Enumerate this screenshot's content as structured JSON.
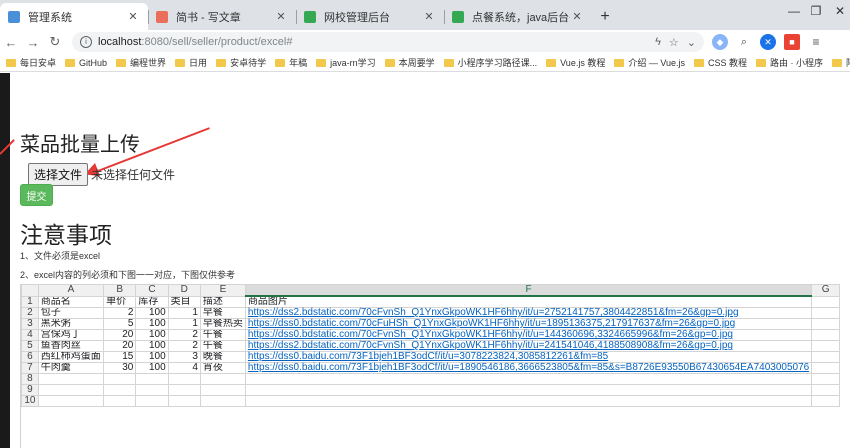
{
  "browser": {
    "tabs": [
      {
        "title": "管理系统",
        "favicon_color": "#4a90d9",
        "active": true
      },
      {
        "title": "简书 - 写文章",
        "favicon_color": "#ea6f5a",
        "active": false
      },
      {
        "title": "网校管理后台",
        "favicon_color": "#34a853",
        "active": false
      },
      {
        "title": "点餐系统，java后台+点餐小程序 - ",
        "favicon_color": "#34a853",
        "active": false
      }
    ],
    "new_tab": "+",
    "window": {
      "minimize": "—",
      "maximize": "❐",
      "close": "✕"
    },
    "url_host": "localhost",
    "url_path": ":8080/sell/seller/product/excel#",
    "nav": {
      "back": "←",
      "forward": "→",
      "reload": "↻"
    },
    "bookmarks": [
      "每日安卓",
      "GitHub",
      "编程世界",
      "日用",
      "安卓待学",
      "年稿",
      "java-rn学习",
      "本周要学",
      "小程序学习路径课...",
      "Vue.js 教程",
      "介绍 — Vue.js",
      "CSS 教程",
      "路由 · 小程序",
      "阿里云推荐有礼活动"
    ],
    "bookmarks_more": "»"
  },
  "page": {
    "upload_heading": "菜品批量上传",
    "choose_file_button": "选择文件",
    "no_file_text": "未选择任何文件",
    "submit_button": "提交",
    "notes_heading": "注意事项",
    "notes": [
      "1、文件必须是excel",
      "2、excel内容的列必须和下图一一对应，下图仅供参考"
    ]
  },
  "sheet": {
    "col_letters": [
      "A",
      "B",
      "C",
      "D",
      "E",
      "F",
      "G"
    ],
    "rows": [
      {
        "n": "1",
        "cells": [
          "商品名",
          "单价",
          "库存",
          "类目",
          "描述",
          "商品图片",
          ""
        ]
      },
      {
        "n": "2",
        "cells": [
          "包子",
          "2",
          "100",
          "1",
          "早餐",
          "https://dss2.bdstatic.com/70cFvnSh_Q1YnxGkpoWK1HF6hhy/it/u=2752141757,3804422851&fm=26&gp=0.jpg",
          ""
        ]
      },
      {
        "n": "3",
        "cells": [
          "黑米粥",
          "5",
          "100",
          "1",
          "早餐热卖",
          "https://dss0.bdstatic.com/70cFuHSh_Q1YnxGkpoWK1HF6hhy/it/u=1895136375,217917637&fm=26&gp=0.jpg",
          ""
        ]
      },
      {
        "n": "4",
        "cells": [
          "宫保鸡丁",
          "20",
          "100",
          "2",
          "午餐",
          "https://dss0.bdstatic.com/70cFvnSh_Q1YnxGkpoWK1HF6hhy/it/u=144360696,3324665996&fm=26&gp=0.jpg",
          ""
        ]
      },
      {
        "n": "5",
        "cells": [
          "鱼香肉丝",
          "20",
          "100",
          "2",
          "午餐",
          "https://dss2.bdstatic.com/70cFvnSh_Q1YnxGkpoWK1HF6hhy/it/u=241541046,4188508908&fm=26&gp=0.jpg",
          ""
        ]
      },
      {
        "n": "6",
        "cells": [
          "西红柿鸡蛋面",
          "15",
          "100",
          "3",
          "晚餐",
          "https://dss0.baidu.com/73F1bjeh1BF3odCf/it/u=3078223824,3085812261&fm=85",
          ""
        ]
      },
      {
        "n": "7",
        "cells": [
          "牛肉羹",
          "30",
          "100",
          "4",
          "宵夜",
          "https://dss0.baidu.com/73F1bjeh1BF3odCf/it/u=1890546186,3666523805&fm=85&s=B8726E93550B67430654EA7403005076",
          ""
        ]
      },
      {
        "n": "8",
        "cells": [
          "",
          "",
          "",
          "",
          "",
          "",
          ""
        ]
      },
      {
        "n": "9",
        "cells": [
          "",
          "",
          "",
          "",
          "",
          "",
          ""
        ]
      },
      {
        "n": "10",
        "cells": [
          "",
          "",
          "",
          "",
          "",
          "",
          ""
        ]
      }
    ]
  },
  "colors": {
    "submit": "#5cb85c",
    "annotation_arrow": "#e53935",
    "link": "#0563c1",
    "excel_green": "#217346"
  }
}
